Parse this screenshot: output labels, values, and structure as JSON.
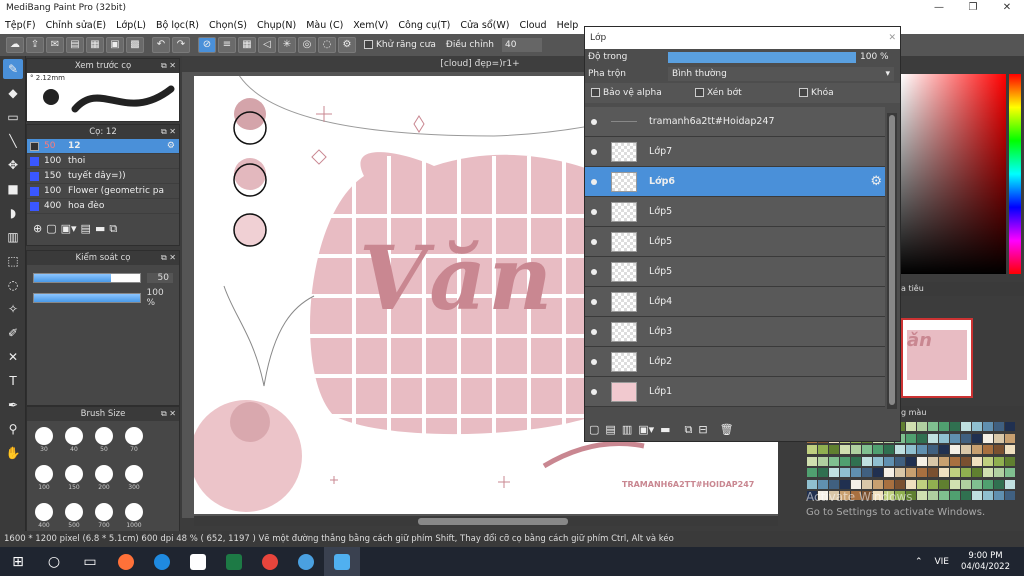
{
  "window": {
    "title": "MediBang Paint Pro (32bit)"
  },
  "menu": [
    "Tệp(F)",
    "Chỉnh sửa(E)",
    "Lớp(L)",
    "Bộ lọc(R)",
    "Chọn(S)",
    "Chụp(N)",
    "Màu (C)",
    "Xem(V)",
    "Công cụ(T)",
    "Cửa sổ(W)",
    "Cloud",
    "Help"
  ],
  "toolbar": {
    "antialias_label": "Khử răng cưa",
    "adjust_label": "Điều chỉnh",
    "adjust_value": "40"
  },
  "preview": {
    "title": "Xem trước cọ",
    "size": "2.12mm"
  },
  "brush": {
    "title": "Cọ: 12",
    "items": [
      {
        "size": "50",
        "name": "12"
      },
      {
        "size": "100",
        "name": "thoi"
      },
      {
        "size": "150",
        "name": "tuyết dây=))"
      },
      {
        "size": "100",
        "name": "Flower (geometric patt"
      },
      {
        "size": "400",
        "name": "hoa đèo"
      }
    ]
  },
  "brush_control": {
    "title": "Kiểm soát cọ",
    "size_value": "50",
    "size_fraction": 0.73,
    "opacity_label": "100 %",
    "opacity_fraction": 1.0
  },
  "brush_size": {
    "title": "Brush Size",
    "sizes": [
      "30",
      "40",
      "50",
      "70",
      "100",
      "150",
      "200",
      "300",
      "400",
      "500",
      "700",
      "1000"
    ]
  },
  "canvas": {
    "tab": "[cloud] đẹp=)r1+",
    "big_text": "Văn",
    "watermark": "TRAMANH6A2TT#HOIDAP247"
  },
  "layer_panel": {
    "title": "Lớp",
    "opacity_label": "Độ trong",
    "opacity_value": "100 %",
    "opacity_fraction": 1.0,
    "blend_label": "Pha trộn",
    "blend_value": "Bình thường",
    "protect_alpha": "Bảo vệ alpha",
    "clipping": "Xén bớt",
    "lock": "Khóa",
    "layers": [
      "tramanh6a2tt#Hoidap247",
      "Lớp7",
      "Lớp6",
      "Lớp5",
      "Lớp5",
      "Lớp5",
      "Lớp4",
      "Lớp3",
      "Lớp2",
      "Lớp1"
    ]
  },
  "right_panel": {
    "navigator_partial": "a tiêu",
    "palette_partial": "g màu"
  },
  "activation": {
    "line1": "Activate Windows",
    "line2": "Go to Settings to activate Windows."
  },
  "status": {
    "text": "1600 * 1200 pixel   (6.8 * 5.1cm)   600 dpi   48 %   ( 652, 1197 )   Vẽ một đường thẳng bằng cách giữ phím Shift, Thay đổi cỡ cọ bằng cách giữ phím Ctrl, Alt và kéo"
  },
  "taskbar": {
    "lang": "VIE",
    "time": "9:00 PM",
    "date": "04/04/2022"
  },
  "colors": {
    "accent": "#4a90d9",
    "pink": "#e8bcc3",
    "dark_pink": "#c98791"
  }
}
